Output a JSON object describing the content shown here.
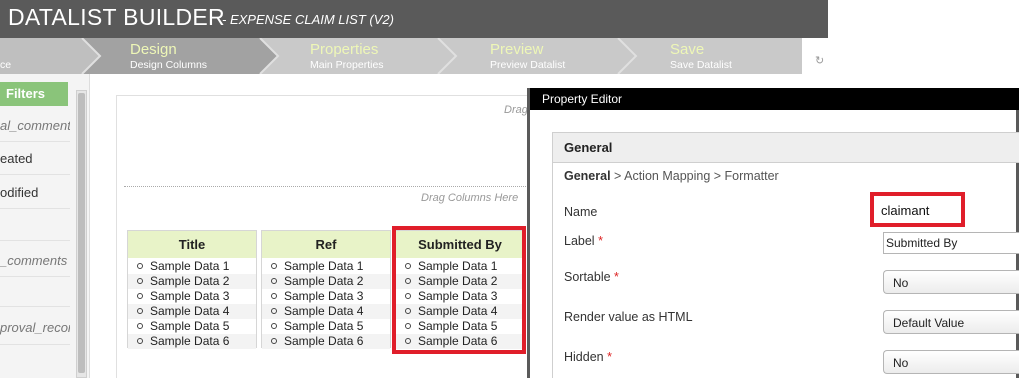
{
  "header": {
    "title": "DATALIST BUILDER",
    "subtitle": "- EXPENSE CLAIM LIST (V2)"
  },
  "wizard": {
    "prev_fragment": "ce",
    "steps": [
      {
        "title": "Design",
        "subtitle": "Design Columns"
      },
      {
        "title": "Properties",
        "subtitle": "Main Properties"
      },
      {
        "title": "Preview",
        "subtitle": "Preview Datalist"
      },
      {
        "title": "Save",
        "subtitle": "Save Datalist"
      }
    ]
  },
  "sidebar": {
    "filters_label": "Filters",
    "items": [
      "al_comment",
      "eated",
      "odified",
      "_comments",
      "proval_recor"
    ]
  },
  "canvas": {
    "drag_top": "Drag",
    "drag_columns": "Drag Columns Here",
    "columns": [
      {
        "header": "Title",
        "rows": [
          "Sample Data 1",
          "Sample Data 2",
          "Sample Data 3",
          "Sample Data 4",
          "Sample Data 5",
          "Sample Data 6"
        ]
      },
      {
        "header": "Ref",
        "rows": [
          "Sample Data 1",
          "Sample Data 2",
          "Sample Data 3",
          "Sample Data 4",
          "Sample Data 5",
          "Sample Data 6"
        ]
      },
      {
        "header": "Submitted By",
        "rows": [
          "Sample Data 1",
          "Sample Data 2",
          "Sample Data 3",
          "Sample Data 4",
          "Sample Data 5",
          "Sample Data 6"
        ]
      }
    ]
  },
  "dialog": {
    "title": "Property Editor",
    "section": "General",
    "crumb_current": "General",
    "crumb_rest": " > Action Mapping > Formatter",
    "fields": {
      "name_label": "Name",
      "name_value": "claimant",
      "label_label": "Label",
      "label_value": "Submitted By",
      "sortable_label": "Sortable",
      "sortable_value": "No",
      "render_label": "Render value as HTML",
      "render_value": "Default Value",
      "hidden_label": "Hidden",
      "hidden_value": "No",
      "required_marker": "*"
    }
  },
  "colors": {
    "header_bg": "#5a5a5a",
    "wizard_bg": "#c9c9c9",
    "filters_tab": "#8ac47a",
    "column_header": "#e8f3c8",
    "highlight": "#e01e2a"
  },
  "icons": {
    "refresh": "refresh-icon"
  }
}
